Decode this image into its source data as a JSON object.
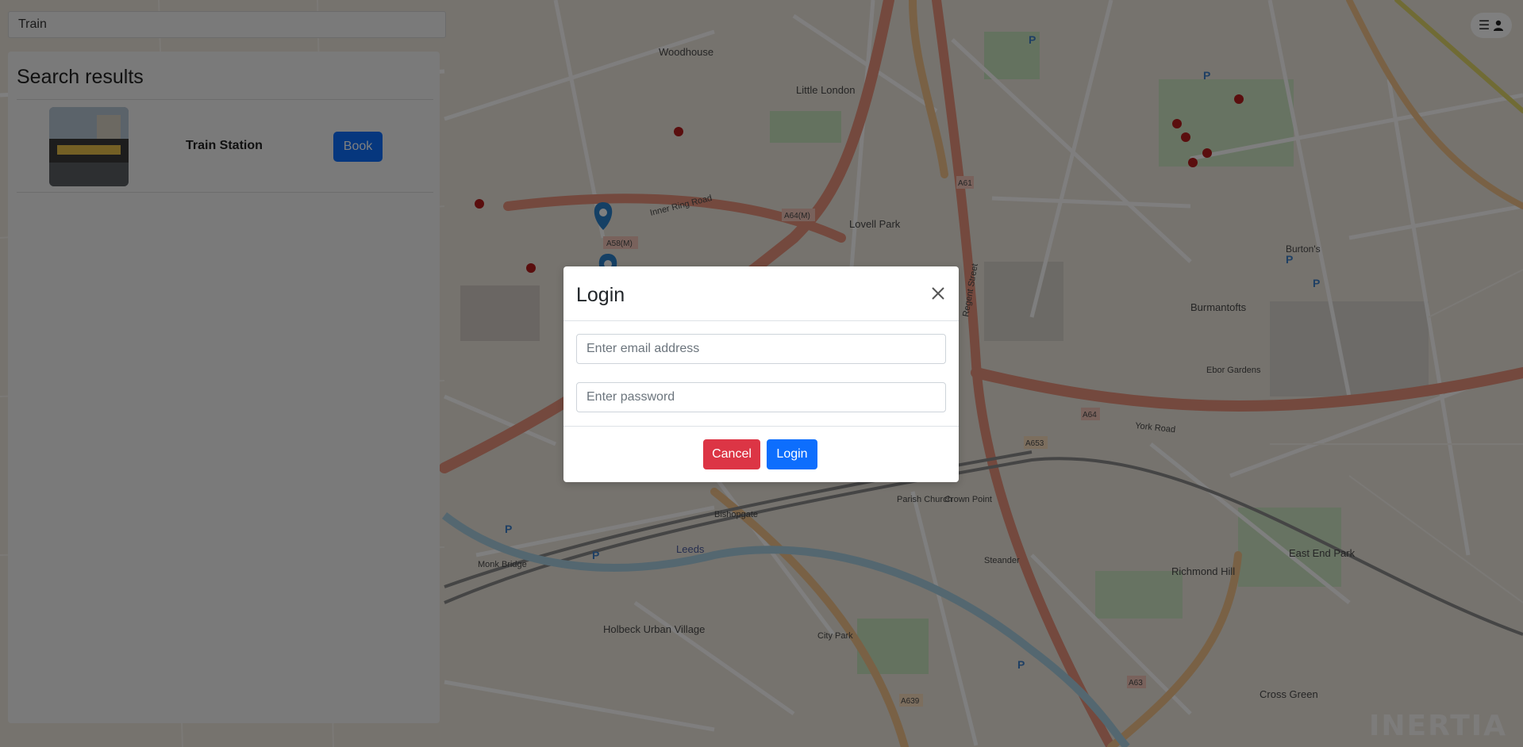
{
  "search": {
    "value": "Train"
  },
  "results": {
    "title": "Search results",
    "items": [
      {
        "name": "Train Station",
        "action": "Book"
      }
    ]
  },
  "map": {
    "labels": [
      "Woodhouse",
      "Little London",
      "Lovell Park",
      "Burmantofts",
      "Leeds",
      "Richmond Hill",
      "East End Park",
      "Holbeck Urban Village",
      "Cross Green",
      "Inner Ring Road",
      "York Road",
      "Regent Street",
      "A58(M)",
      "A64(M)",
      "A61",
      "A64",
      "A653",
      "A639",
      "A63",
      "Ebor Gardens",
      "Bishopgate",
      "Parish Church",
      "Crown Point",
      "Steander",
      "Burton's",
      "City Park",
      "Monk Bridge"
    ],
    "watermark": "INERTIA"
  },
  "modal": {
    "title": "Login",
    "email_placeholder": "Enter email address",
    "password_placeholder": "Enter password",
    "cancel_label": "Cancel",
    "login_label": "Login"
  },
  "colors": {
    "primary": "#0d6efd",
    "danger": "#dc3545",
    "road_major": "#e8927c",
    "road_trunk": "#f2c38a"
  },
  "icons": {
    "menu": "menu-icon",
    "user": "user-icon",
    "close": "close-icon",
    "marker": "map-marker-icon"
  }
}
